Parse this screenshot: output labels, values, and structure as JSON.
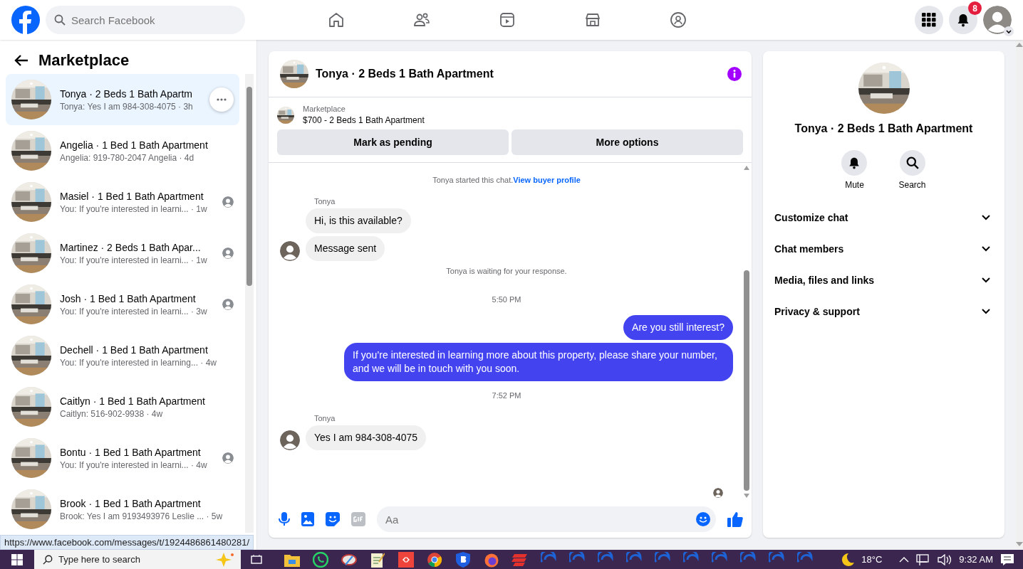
{
  "top_bar": {
    "search": {
      "placeholder": "Search Facebook"
    },
    "notification_count": "8"
  },
  "sidebar": {
    "title": "Marketplace",
    "conversations": [
      {
        "title": "Tonya · 2 Beds 1 Bath Apartm",
        "preview": "Tonya: Yes I am 984-308-4075 · 3h",
        "selected": true,
        "seen": false
      },
      {
        "title": "Angelia · 1 Bed 1 Bath Apartment",
        "preview": "Angelia: 919-780-2047 Angelia · 4d",
        "selected": false,
        "seen": false
      },
      {
        "title": "Masiel · 1 Bed 1 Bath Apartment",
        "preview": "You: If you're interested in learni... · 1w",
        "selected": false,
        "seen": true
      },
      {
        "title": "Martinez · 2 Beds 1 Bath Apar...",
        "preview": "You: If you're interested in learni... · 1w",
        "selected": false,
        "seen": true
      },
      {
        "title": "Josh · 1 Bed 1 Bath Apartment",
        "preview": "You: If you're interested in learni... · 3w",
        "selected": false,
        "seen": true
      },
      {
        "title": "Dechell · 1 Bed 1 Bath Apartment",
        "preview": "You: If you're interested in learning... · 4w",
        "selected": false,
        "seen": false
      },
      {
        "title": "Caitlyn · 1 Bed 1 Bath Apartment",
        "preview": "Caitlyn: 516-902-9938 · 4w",
        "selected": false,
        "seen": false
      },
      {
        "title": "Bontu · 1 Bed 1 Bath Apartment",
        "preview": "You: If you're interested in learni... · 4w",
        "selected": false,
        "seen": true
      },
      {
        "title": "Brook · 1 Bed 1 Bath Apartment",
        "preview": "Brook: Yes I am 9193493976 Leslie ... · 5w",
        "selected": false,
        "seen": false
      }
    ]
  },
  "chat": {
    "title": "Tonya · 2 Beds 1 Bath Apartment",
    "listing": {
      "label": "Marketplace",
      "title": "$700 - 2 Beds 1 Bath Apartment"
    },
    "buttons": [
      "Mark as pending",
      "More options"
    ],
    "messages": [
      {
        "kind": "notice",
        "text": "Tonya started this chat.",
        "link": "View buyer profile"
      },
      {
        "kind": "incoming",
        "sender": "Tonya",
        "bubbles": [
          "Hi, is this available?",
          "Message sent"
        ]
      },
      {
        "kind": "notice",
        "text": "Tonya is waiting for your response."
      },
      {
        "kind": "time",
        "text": "5:50 PM"
      },
      {
        "kind": "outgoing",
        "bubbles": [
          "Are you still interest?",
          "If you’re interested in learning more about this property, please share your number, and we will be in touch with you soon."
        ]
      },
      {
        "kind": "time",
        "text": "7:52 PM"
      },
      {
        "kind": "incoming",
        "sender": "Tonya",
        "bubbles": [
          "Yes I am 984-308-4075"
        ]
      }
    ],
    "composer": {
      "placeholder": "Aa"
    }
  },
  "details": {
    "title": "Tonya · 2 Beds 1 Bath Apartment",
    "actions": [
      {
        "kind": "bell",
        "label": "Mute"
      },
      {
        "kind": "search",
        "label": "Search"
      }
    ],
    "sections": [
      {
        "label": "Customize chat",
        "expanded": false
      },
      {
        "label": "Chat members",
        "expanded": false
      },
      {
        "label": "Media, files and links",
        "expanded": false
      },
      {
        "label": "Privacy & support",
        "expanded": false
      }
    ]
  },
  "status_url": "https://www.facebook.com/messages/t/1924486861480281/",
  "taskbar": {
    "search": {
      "placeholder": "Type here to search"
    },
    "weather": "18°C",
    "time": "9:32 AM"
  }
}
